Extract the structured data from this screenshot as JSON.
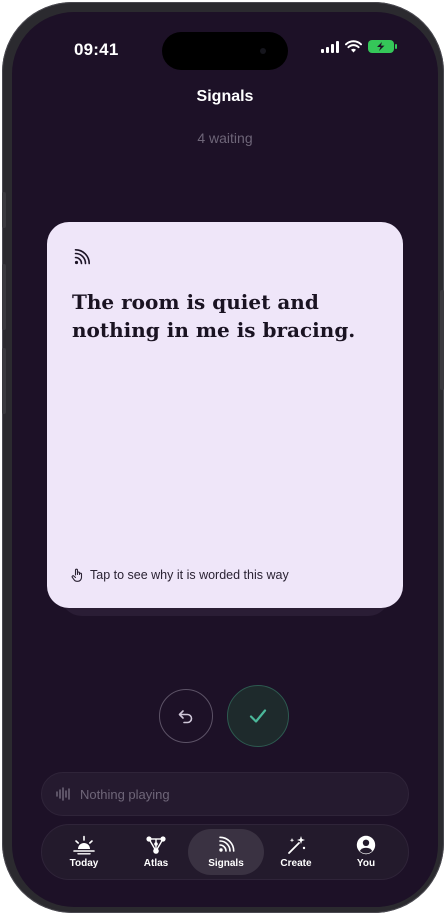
{
  "status_bar": {
    "time": "09:41",
    "icons": [
      "signal-icon",
      "wifi-icon",
      "battery-charging-icon"
    ],
    "battery_color": "#35c759"
  },
  "header": {
    "title": "Signals",
    "subtitle": "4 waiting"
  },
  "card": {
    "icon": "signal-waves-icon",
    "text": "The room is quiet and nothing in me is bracing.",
    "hint": "Tap to see why it is worded this way",
    "hint_icon": "tap-hand-icon",
    "background": "#efe6f9"
  },
  "actions": {
    "undo_icon": "undo-arrow-icon",
    "confirm_icon": "checkmark-icon",
    "confirm_color": "#4bb89a"
  },
  "player": {
    "icon": "waveform-icon",
    "label": "Nothing playing"
  },
  "tabs": [
    {
      "id": "today",
      "label": "Today",
      "icon": "sunrise-icon",
      "active": false
    },
    {
      "id": "atlas",
      "label": "Atlas",
      "icon": "nodes-icon",
      "active": false
    },
    {
      "id": "signals",
      "label": "Signals",
      "icon": "signal-waves-icon",
      "active": true
    },
    {
      "id": "create",
      "label": "Create",
      "icon": "magic-wand-icon",
      "active": false
    },
    {
      "id": "you",
      "label": "You",
      "icon": "profile-icon",
      "active": false
    }
  ],
  "colors": {
    "background": "#1d1127",
    "accent": "#4bb89a"
  }
}
